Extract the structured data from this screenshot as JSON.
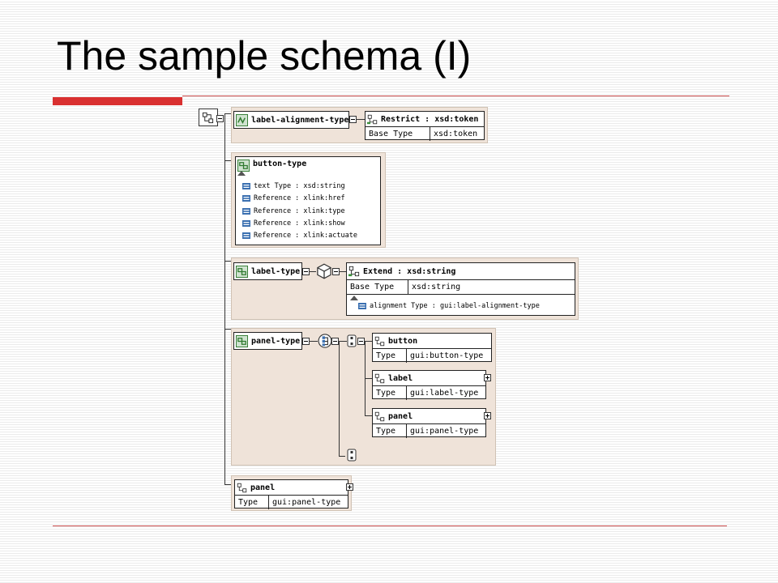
{
  "slide": {
    "title": "The sample schema (I)"
  },
  "icons": {
    "schema_root": "schema-tree-icon",
    "simple_type": "simple-type-icon",
    "complex_type": "complex-type-icon",
    "element": "element-icon",
    "attribute": "attribute-icon",
    "sequence": "sequence-icon",
    "choice": "choice-icon",
    "any": "any-icon"
  },
  "colors": {
    "panel": "#efe3d9",
    "accent_red": "#d93030",
    "icon_green": "#3a8f3a",
    "icon_blue": "#3a6fb0"
  },
  "diagram": {
    "label_alignment_type": {
      "name": "label-alignment-type",
      "restrict": {
        "title": "Restrict  :  xsd:token",
        "row_label": "Base Type",
        "row_value": "xsd:token"
      }
    },
    "button_type": {
      "name": "button-type",
      "attributes": [
        "text Type : xsd:string",
        "Reference : xlink:href",
        "Reference : xlink:type",
        "Reference : xlink:show",
        "Reference : xlink:actuate"
      ]
    },
    "label_type": {
      "name": "label-type",
      "extend": {
        "title": "Extend  :  xsd:string",
        "row_label": "Base Type",
        "row_value": "xsd:string",
        "attribute": "alignment Type : gui:label-alignment-type"
      }
    },
    "panel_type": {
      "name": "panel-type",
      "elements": [
        {
          "name": "button",
          "type_label": "Type",
          "type_value": "gui:button-type"
        },
        {
          "name": "label",
          "type_label": "Type",
          "type_value": "gui:label-type"
        },
        {
          "name": "panel",
          "type_label": "Type",
          "type_value": "gui:panel-type"
        }
      ]
    },
    "panel_element": {
      "name": "panel",
      "type_label": "Type",
      "type_value": "gui:panel-type"
    }
  }
}
